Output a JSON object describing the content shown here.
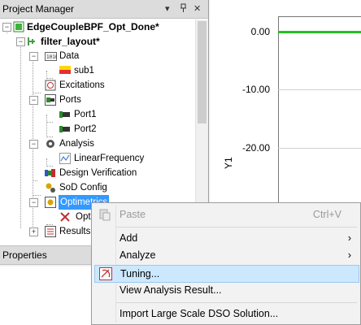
{
  "project_manager": {
    "title": "Project Manager",
    "controls": [
      "▾",
      "ᵖ",
      "✕"
    ],
    "tree": [
      {
        "label": "EdgeCoupleBPF_Opt_Done*",
        "level": 0,
        "expander": "−",
        "icon": "project-icon",
        "bold": true
      },
      {
        "label": "filter_layout*",
        "level": 1,
        "expander": "−",
        "icon": "layout-icon",
        "bold": true
      },
      {
        "label": "Data",
        "level": 2,
        "expander": "−",
        "icon": "data-folder-icon"
      },
      {
        "label": "sub1",
        "level": 3,
        "expander": "",
        "icon": "substrate-icon"
      },
      {
        "label": "Excitations",
        "level": 2,
        "expander": "",
        "icon": "excitations-icon"
      },
      {
        "label": "Ports",
        "level": 2,
        "expander": "−",
        "icon": "ports-icon"
      },
      {
        "label": "Port1",
        "level": 3,
        "expander": "",
        "icon": "port-icon"
      },
      {
        "label": "Port2",
        "level": 3,
        "expander": "",
        "icon": "port-icon"
      },
      {
        "label": "Analysis",
        "level": 2,
        "expander": "−",
        "icon": "analysis-gear-icon"
      },
      {
        "label": "LinearFrequency",
        "level": 3,
        "expander": "",
        "icon": "linear-frequency-icon"
      },
      {
        "label": "Design Verification",
        "level": 2,
        "expander": "",
        "icon": "design-verification-icon"
      },
      {
        "label": "SoD Config",
        "level": 2,
        "expander": "",
        "icon": "sod-config-icon"
      },
      {
        "label": "Optimetrics",
        "level": 2,
        "expander": "−",
        "icon": "optimetrics-icon",
        "selected": true
      },
      {
        "label": "Opt",
        "level": 3,
        "expander": "",
        "icon": "optimization-icon"
      },
      {
        "label": "Results",
        "level": 2,
        "expander": "+",
        "icon": "results-icon"
      }
    ]
  },
  "properties": {
    "title": "Properties"
  },
  "plot": {
    "y_ticks": [
      "0.00",
      "-10.00",
      "-20.00"
    ],
    "y_label": "Y1",
    "trace_color": "#22c022"
  },
  "context_menu": {
    "items": [
      {
        "label": "Paste",
        "shortcut": "Ctrl+V",
        "disabled": true,
        "icon": "paste-icon"
      },
      {
        "separator": true
      },
      {
        "label": "Add",
        "submenu": true
      },
      {
        "label": "Analyze",
        "submenu": true
      },
      {
        "label": "Tuning...",
        "highlighted": true,
        "icon": "tuning-icon"
      },
      {
        "label": "View Analysis Result..."
      },
      {
        "separator": true
      },
      {
        "label": "Import Large Scale DSO Solution..."
      }
    ]
  },
  "colors": {
    "selection": "#3399ff",
    "menu_highlight": "#cce8ff",
    "trace": "#22c022"
  }
}
